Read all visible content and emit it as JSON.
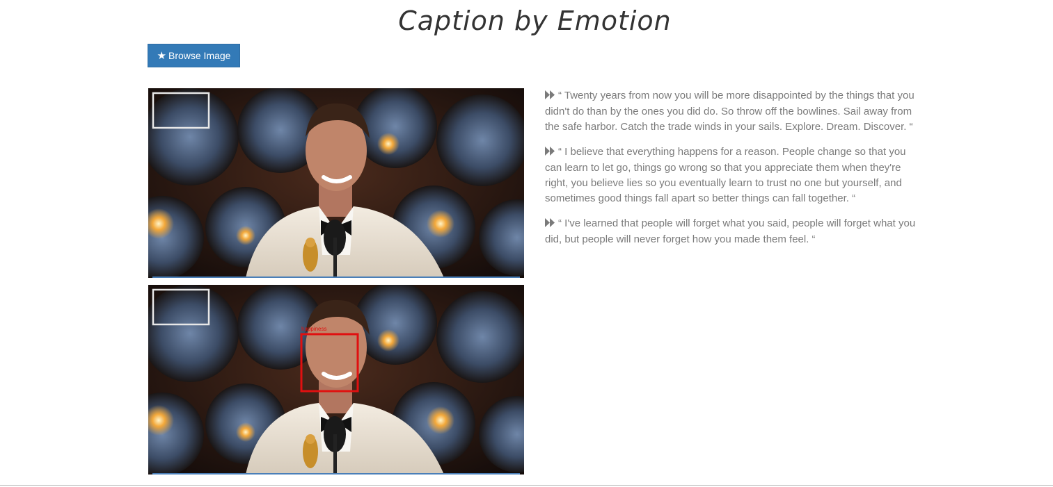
{
  "page": {
    "title": "Caption by Emotion"
  },
  "toolbar": {
    "browse_label": "Browse Image",
    "browse_icon": "star-icon"
  },
  "images": {
    "original_alt": "Uploaded photo",
    "annotated_alt": "Photo with detected face",
    "face_label": "happiness"
  },
  "quotes": [
    {
      "icon": "fast-forward-icon",
      "text": "“ Twenty years from now you will be more disappointed by the things that you didn't do than by the ones you did do. So throw off the bowlines. Sail away from the safe harbor. Catch the trade winds in your sails. Explore. Dream. Discover. “"
    },
    {
      "icon": "fast-forward-icon",
      "text": "“ I believe that everything happens for a reason. People change so that you can learn to let go, things go wrong so that you appreciate them when they're right, you believe lies so you eventually learn to trust no one but yourself, and sometimes good things fall apart so better things can fall together. “"
    },
    {
      "icon": "fast-forward-icon",
      "text": "“ I've learned that people will forget what you said, people will forget what you did, but people will never forget how you made them feel. “"
    }
  ],
  "colors": {
    "accent": "#337ab7",
    "face_box": "#e01010",
    "quote_text": "#7a7a7a"
  }
}
